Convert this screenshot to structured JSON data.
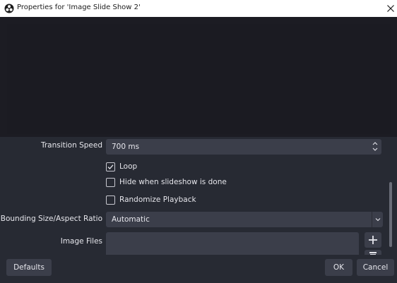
{
  "window": {
    "title": "Properties for 'Image Slide Show 2'",
    "icons": {
      "app": "obs-logo-icon",
      "close": "close-icon"
    }
  },
  "properties": {
    "transition_speed": {
      "label": "Transition Speed",
      "value": "700 ms"
    },
    "loop": {
      "label": "Loop",
      "checked": true
    },
    "hide_when_done": {
      "label": "Hide when slideshow is done",
      "checked": false
    },
    "randomize": {
      "label": "Randomize Playback",
      "checked": false
    },
    "bounding_size": {
      "label": "Bounding Size/Aspect Ratio",
      "value": "Automatic"
    },
    "image_files": {
      "label": "Image Files",
      "add_icon": "plus-icon",
      "remove_icon": "trash-icon"
    }
  },
  "footer": {
    "defaults_label": "Defaults",
    "ok_label": "OK",
    "cancel_label": "Cancel"
  },
  "colors": {
    "background": "#1f1f26",
    "panel": "#272a33",
    "field": "#3b3e4a",
    "text": "#e6e6ec"
  }
}
